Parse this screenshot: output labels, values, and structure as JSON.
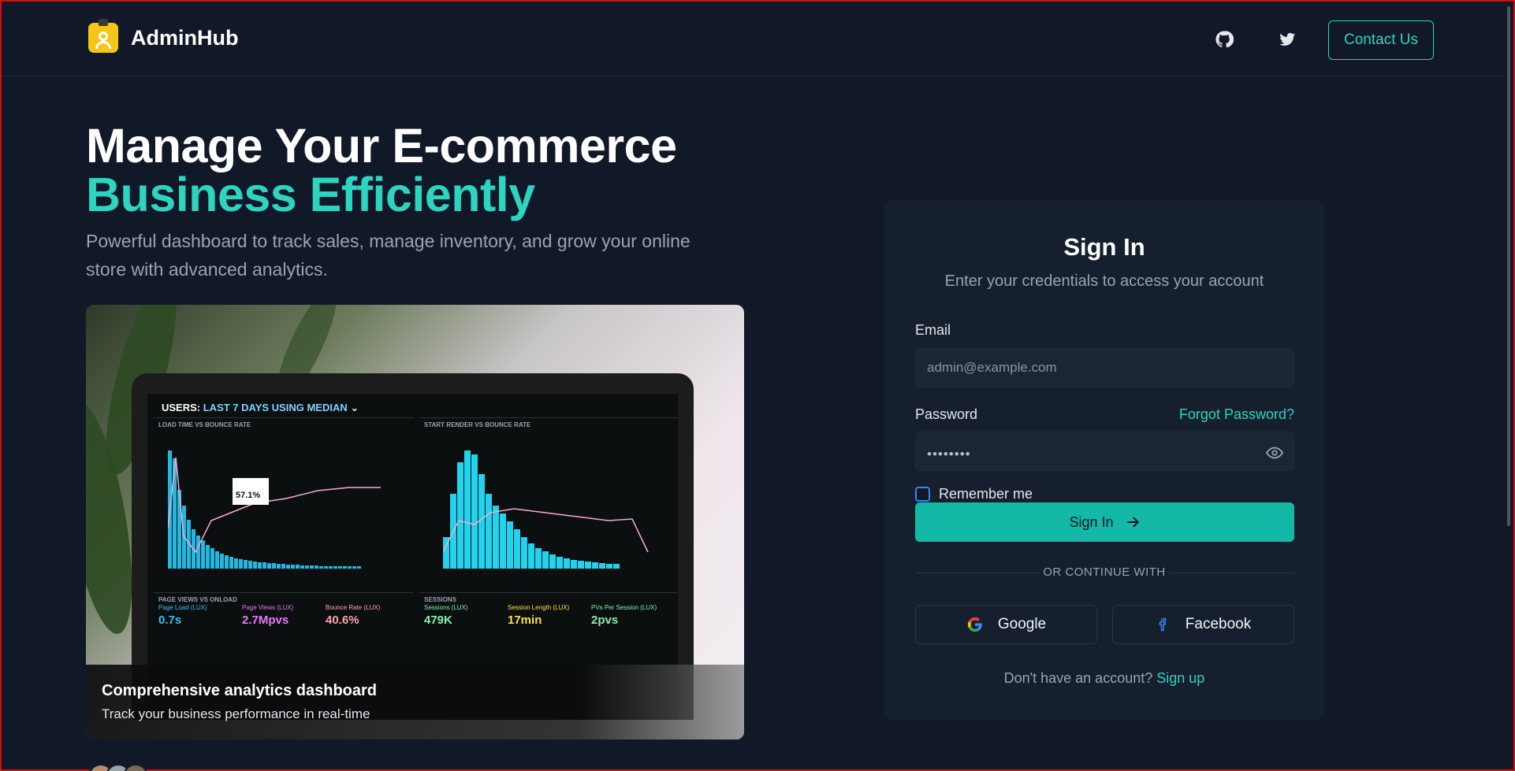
{
  "header": {
    "brand_name": "AdminHub",
    "icons": [
      "github-icon",
      "twitter-icon"
    ],
    "contact_label": "Contact Us"
  },
  "hero": {
    "title_line1": "Manage Your E-commerce",
    "title_line2": "Business Efficiently",
    "subtitle": "Powerful dashboard to track sales, manage inventory, and grow your online store with advanced analytics.",
    "image_caption_title": "Comprehensive analytics dashboard",
    "image_caption_sub": "Track your business performance in real-time"
  },
  "dashboard_image": {
    "heading_prefix": "USERS: ",
    "heading_highlight": "LAST 7 DAYS USING MEDIAN",
    "panel1_title": "LOAD TIME VS BOUNCE RATE",
    "panel2_title": "START RENDER VS BOUNCE RATE",
    "panel3_title": "PAGE VIEWS VS ONLOAD",
    "panel4_title": "SESSIONS",
    "tooltip_value": "57.1%",
    "metrics": [
      {
        "label": "Page Load (LUX)",
        "value": "0.7s",
        "color": "#38bdf8"
      },
      {
        "label": "Page Views (LUX)",
        "value": "2.7Mpvs",
        "color": "#e879f9"
      },
      {
        "label": "Bounce Rate (LUX)",
        "value": "40.6%",
        "color": "#fda4af"
      },
      {
        "label": "Sessions (LUX)",
        "value": "479K",
        "color": "#86efac"
      },
      {
        "label": "Session Length (LUX)",
        "value": "17min",
        "color": "#fde047"
      },
      {
        "label": "PVs Per Session (LUX)",
        "value": "2pvs",
        "color": "#86efac"
      }
    ]
  },
  "signin": {
    "title": "Sign In",
    "subtitle": "Enter your credentials to access your account",
    "email_label": "Email",
    "email_placeholder": "admin@example.com",
    "password_label": "Password",
    "forgot_label": "Forgot Password?",
    "password_mask": "••••••••",
    "remember_label": "Remember me",
    "submit_label": "Sign In",
    "divider_text": "OR CONTINUE WITH",
    "google_label": "Google",
    "facebook_label": "Facebook",
    "signup_prompt": "Don't have an account?",
    "signup_link": "Sign up"
  },
  "colors": {
    "accent": "#2dd4bf",
    "background": "#111827",
    "card": "#161f2e",
    "button": "#14b8a6"
  }
}
